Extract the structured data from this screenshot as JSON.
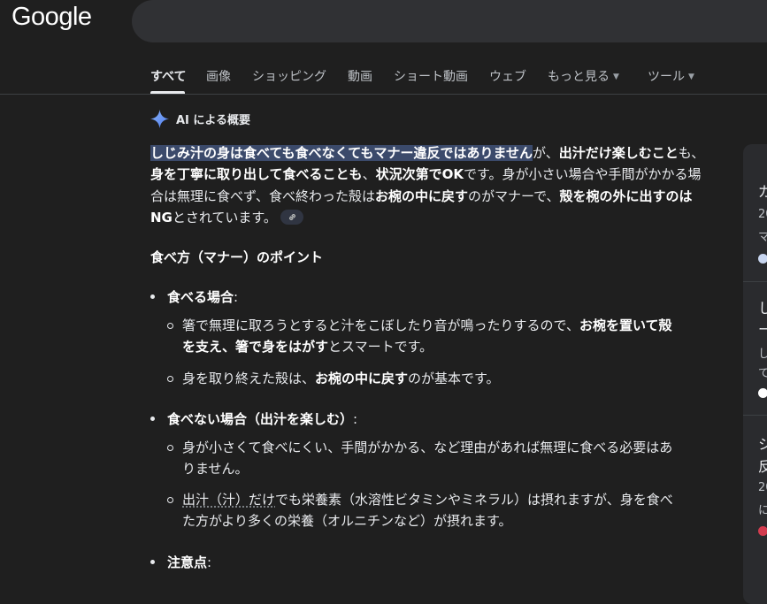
{
  "logo": "Google",
  "tabs": [
    {
      "label": "すべて"
    },
    {
      "label": "画像"
    },
    {
      "label": "ショッピング"
    },
    {
      "label": "動画"
    },
    {
      "label": "ショート動画"
    },
    {
      "label": "ウェブ"
    },
    {
      "label": "もっと見る"
    },
    {
      "label": "ツール"
    }
  ],
  "ai": {
    "title": "AI による概要"
  },
  "lead": {
    "p1": "しじみ汁の身は食べても食べなくてもマナー違反ではありません",
    "p2": "が、",
    "p3": "出汁だけ楽しむこと",
    "p4": "も、",
    "p5": "身を丁寧に取り出して食べることも",
    "p6": "、",
    "p7": "状況次第でOK",
    "p8": "です。身が小さい場合や手間がかかる場合は無理に食べず、食べ終わった殻は",
    "p9": "お椀の中に戻す",
    "p10": "のがマナーで、",
    "p11": "殻を椀の外に出すのはNG",
    "p12": "とされています。"
  },
  "section_title": "食べ方（マナー）のポイント",
  "bullets": {
    "b1": {
      "label": "食べる場合",
      "colon": ":"
    },
    "b1s1": {
      "t1": "箸で無理に取ろうとすると汁をこぼしたり音が鳴ったりするので、",
      "t2": "お椀を置いて殻",
      "t3": "を支え、箸で身をはがす",
      "t4": "とスマートです。",
      "line1": "箸で無理に取ろうとすると汁をこぼしたり音が鳴ったりするので、",
      "line1b": "お椀を置いて殻",
      "line2a": "を支え、箸で身をはがす",
      "line2b": "とスマートです。"
    },
    "b1s2": {
      "t1": "身を取り終えた殻は、",
      "t2": "お椀の中に戻す",
      "t3": "のが基本です。"
    },
    "b2": {
      "label": "食べない場合（出汁を楽しむ）",
      "colon": ":"
    },
    "b2s1": {
      "l1": "身が小さくて食べにくい、手間がかかる、など理由があれば無理に食べる必要はあ",
      "l2": "りません。"
    },
    "b2s2": {
      "u": "出汁（汁）だけ",
      "l1": "でも栄養素（水溶性ビタミンやミネラル）は摂れますが、身を食べ",
      "l2": "た方がより多くの栄養（オルニチンなど）が摂れます。"
    },
    "b3": {
      "label": "注意点",
      "colon": ":"
    }
  },
  "right_panel": {
    "r1": "ガ",
    "r2": "20",
    "r3": "マ",
    "r4": "し",
    "r5": "ー",
    "r6": "し",
    "r7": "て",
    "r8": "シ",
    "r9": "反",
    "r10": "20",
    "r11": "に"
  },
  "colors": {
    "background": "#1f1f1f",
    "highlight": "#3b4a6b",
    "text": "#e8eaed"
  }
}
